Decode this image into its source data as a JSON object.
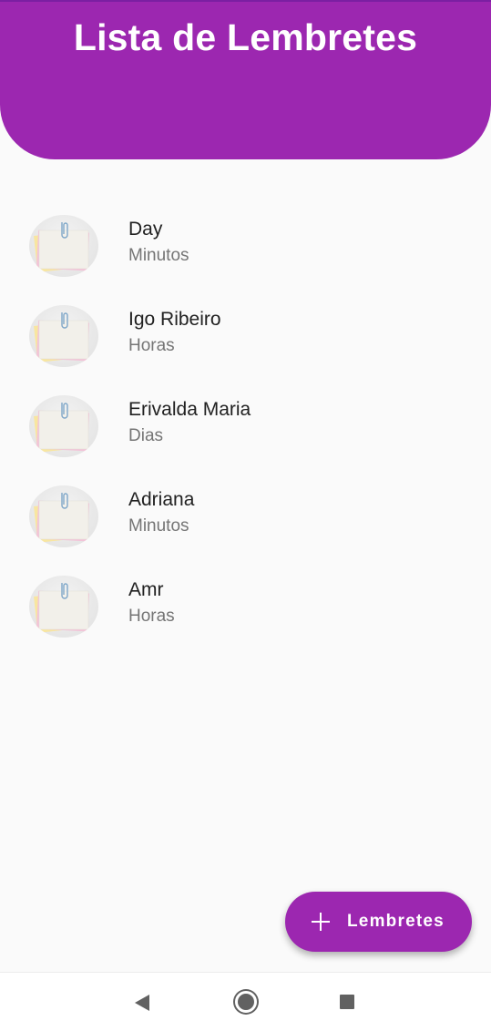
{
  "app_bar": {
    "title": "Lista de Lembretes"
  },
  "reminders": [
    {
      "title": "Day",
      "subtitle": "Minutos",
      "icon": "sticky-note-icon"
    },
    {
      "title": "Igo Ribeiro",
      "subtitle": "Horas",
      "icon": "sticky-note-icon"
    },
    {
      "title": "Erivalda Maria",
      "subtitle": "Dias",
      "icon": "sticky-note-icon"
    },
    {
      "title": "Adriana",
      "subtitle": "Minutos",
      "icon": "sticky-note-icon"
    },
    {
      "title": "Amr",
      "subtitle": "Horas",
      "icon": "sticky-note-icon"
    }
  ],
  "fab": {
    "label": "Lembretes",
    "icon": "plus-icon"
  },
  "nav_bar": {
    "icons": [
      "back-icon",
      "home-icon",
      "recent-apps-icon"
    ]
  },
  "colors": {
    "primary": "#9c27b0",
    "background": "#fafafa",
    "title_text": "#212121",
    "subtitle_text": "#757575"
  }
}
